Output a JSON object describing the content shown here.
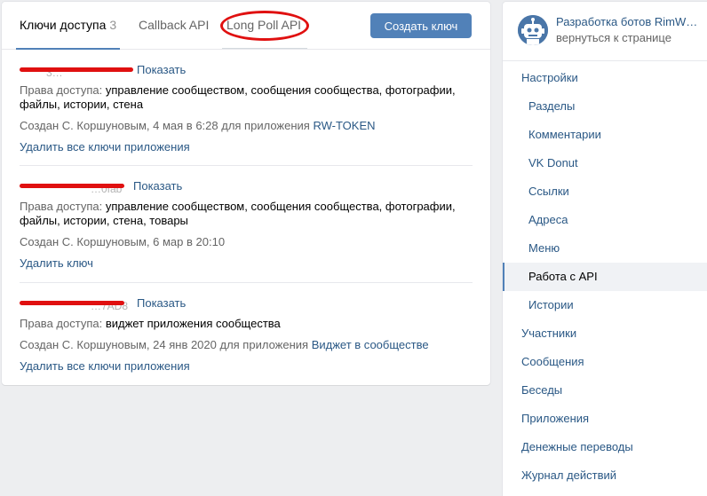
{
  "tabs": [
    {
      "label": "Ключи доступа",
      "count": "3"
    },
    {
      "label": "Callback API"
    },
    {
      "label": "Long Poll API"
    }
  ],
  "create_button": "Создать ключ",
  "keys": [
    {
      "masked_key": "3…",
      "show": "Показать",
      "perm_label": "Права доступа:",
      "perms": "управление сообществом, сообщения сообщества, фотографии, файлы, истории, стена",
      "created_prefix": "Создан С. Коршуновым, 4 мая в 6:28 для приложения",
      "app": "RW-TOKEN",
      "action": "Удалить все ключи приложения"
    },
    {
      "masked_key": "…0fab",
      "show": "Показать",
      "perm_label": "Права доступа:",
      "perms": "управление сообществом, сообщения сообщества, фотографии, файлы, истории, стена, товары",
      "created_prefix": "Создан С. Коршуновым, 6 мар в 20:10",
      "app": "",
      "action": "Удалить ключ"
    },
    {
      "masked_key": "…7AD8",
      "show": "Показать",
      "perm_label": "Права доступа:",
      "perms": "виджет приложения сообщества",
      "created_prefix": "Создан С. Коршуновым, 24 янв 2020 для приложения",
      "app": "Виджет в сообществе",
      "action": "Удалить все ключи приложения"
    }
  ],
  "sidebar": {
    "group_name": "Разработка ботов RimW…",
    "group_back": "вернуться к странице",
    "items": [
      {
        "label": "Настройки",
        "level": "top"
      },
      {
        "label": "Разделы",
        "level": "sub"
      },
      {
        "label": "Комментарии",
        "level": "sub"
      },
      {
        "label": "VK Donut",
        "level": "sub"
      },
      {
        "label": "Ссылки",
        "level": "sub"
      },
      {
        "label": "Адреса",
        "level": "sub"
      },
      {
        "label": "Меню",
        "level": "sub"
      },
      {
        "label": "Работа с API",
        "level": "sub",
        "active": true
      },
      {
        "label": "Истории",
        "level": "sub"
      },
      {
        "label": "Участники",
        "level": "top"
      },
      {
        "label": "Сообщения",
        "level": "top"
      },
      {
        "label": "Беседы",
        "level": "top"
      },
      {
        "label": "Приложения",
        "level": "top"
      },
      {
        "label": "Денежные переводы",
        "level": "top"
      },
      {
        "label": "Журнал действий",
        "level": "top"
      }
    ]
  },
  "colors": {
    "accent": "#5181b8",
    "link": "#2a5885",
    "annotation": "#e01010"
  }
}
